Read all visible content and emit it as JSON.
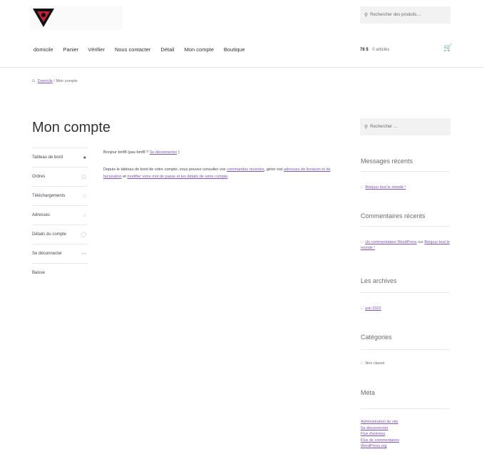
{
  "header": {
    "search_placeholder": "Rechercher des produits…",
    "nav": [
      "domicile",
      "Panier",
      "Vérifier",
      "Nous contacter",
      "Détail",
      "Mon compte",
      "Boutique"
    ],
    "cart_amount": "78 $",
    "cart_items": "0 articles"
  },
  "breadcrumb": {
    "home": "Domicile",
    "sep": "/",
    "current": "Mon compte"
  },
  "page_title": "Mon compte",
  "account_nav": [
    {
      "label": "Tableau de bord",
      "icon": "dashboard-icon"
    },
    {
      "label": "Ordres",
      "icon": "cart-icon"
    },
    {
      "label": "Téléchargements",
      "icon": "file-icon"
    },
    {
      "label": "Adresses",
      "icon": "home-icon"
    },
    {
      "label": "Détails du compte",
      "icon": "user-icon"
    },
    {
      "label": "Se déconnecter",
      "icon": "logout-icon"
    },
    {
      "label": "Baisse",
      "icon": ""
    }
  ],
  "content": {
    "greeting_prefix": "Bonjour bmf8 (pas bmf8 ?",
    "logout_link": "Se déconnecter",
    "greeting_suffix": ")",
    "intro": "Depuis le tableau de bord de votre compte, vous pouvez consulter vos",
    "orders_link": "commandes récentes",
    "mid1": ", gérer vos",
    "addresses_link": "adresses de livraison et de facturation",
    "mid2": "et",
    "password_link": "modifier votre mot de passe et les détails de votre compte",
    "end": "."
  },
  "sidebar": {
    "search_placeholder": "Rechercher …",
    "recent_posts_title": "Messages récents",
    "recent_posts": [
      "Bonjour tout le monde !"
    ],
    "recent_comments_title": "Commentaires récents",
    "comment_author": "Un commentateur WordPress",
    "comment_on": "sur",
    "comment_post": "Bonjour tout le monde !",
    "archives_title": "Les archives",
    "archives": [
      "juin 2022"
    ],
    "categories_title": "Catégories",
    "categories": [
      "Non classé"
    ],
    "meta_title": "Méta",
    "meta": [
      "Administration du site",
      "Se déconnecter",
      "Flux d'entrées",
      "Flux de commentaires",
      "WordPress.org"
    ]
  },
  "colors": {
    "link": "#7f54b3",
    "logo_red": "#c0223a",
    "text": "#43454b"
  }
}
